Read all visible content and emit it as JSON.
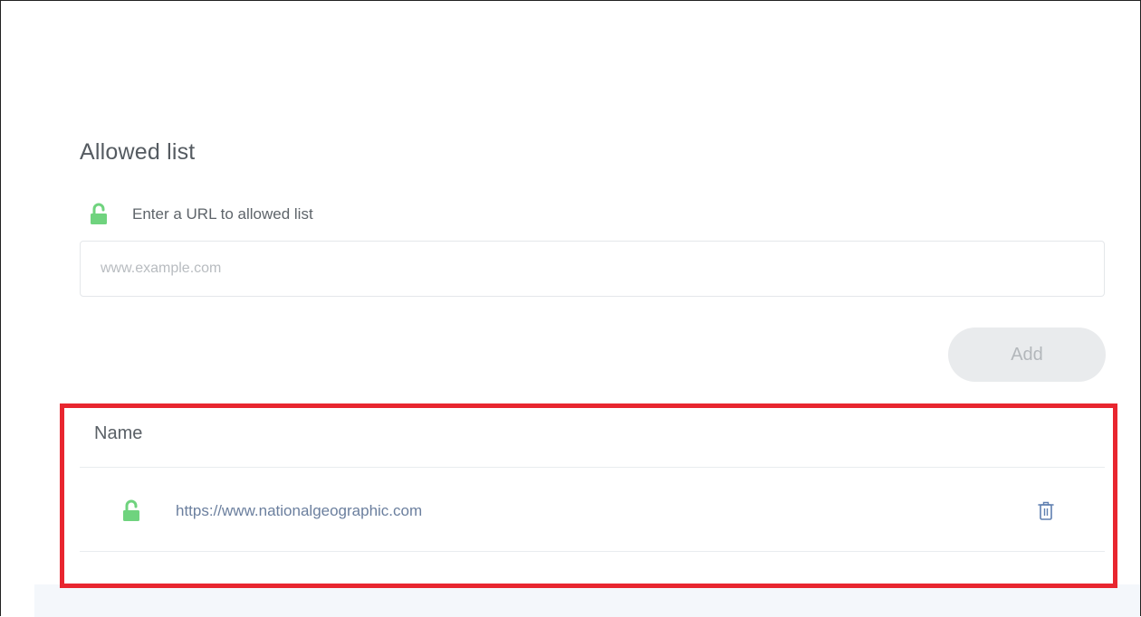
{
  "section": {
    "title": "Allowed list",
    "hint": "Enter a URL to allowed list"
  },
  "input": {
    "placeholder": "www.example.com",
    "value": ""
  },
  "add_button": {
    "label": "Add"
  },
  "table": {
    "header": "Name",
    "rows": [
      {
        "url": "https://www.nationalgeographic.com"
      }
    ]
  },
  "icons": {
    "unlock": "unlock-icon",
    "trash": "trash-icon"
  },
  "colors": {
    "lock_green": "#6fd37e",
    "link_blue": "#6b7f9e",
    "highlight_red": "#e8262f",
    "trash_blue": "#5f7fb0"
  }
}
